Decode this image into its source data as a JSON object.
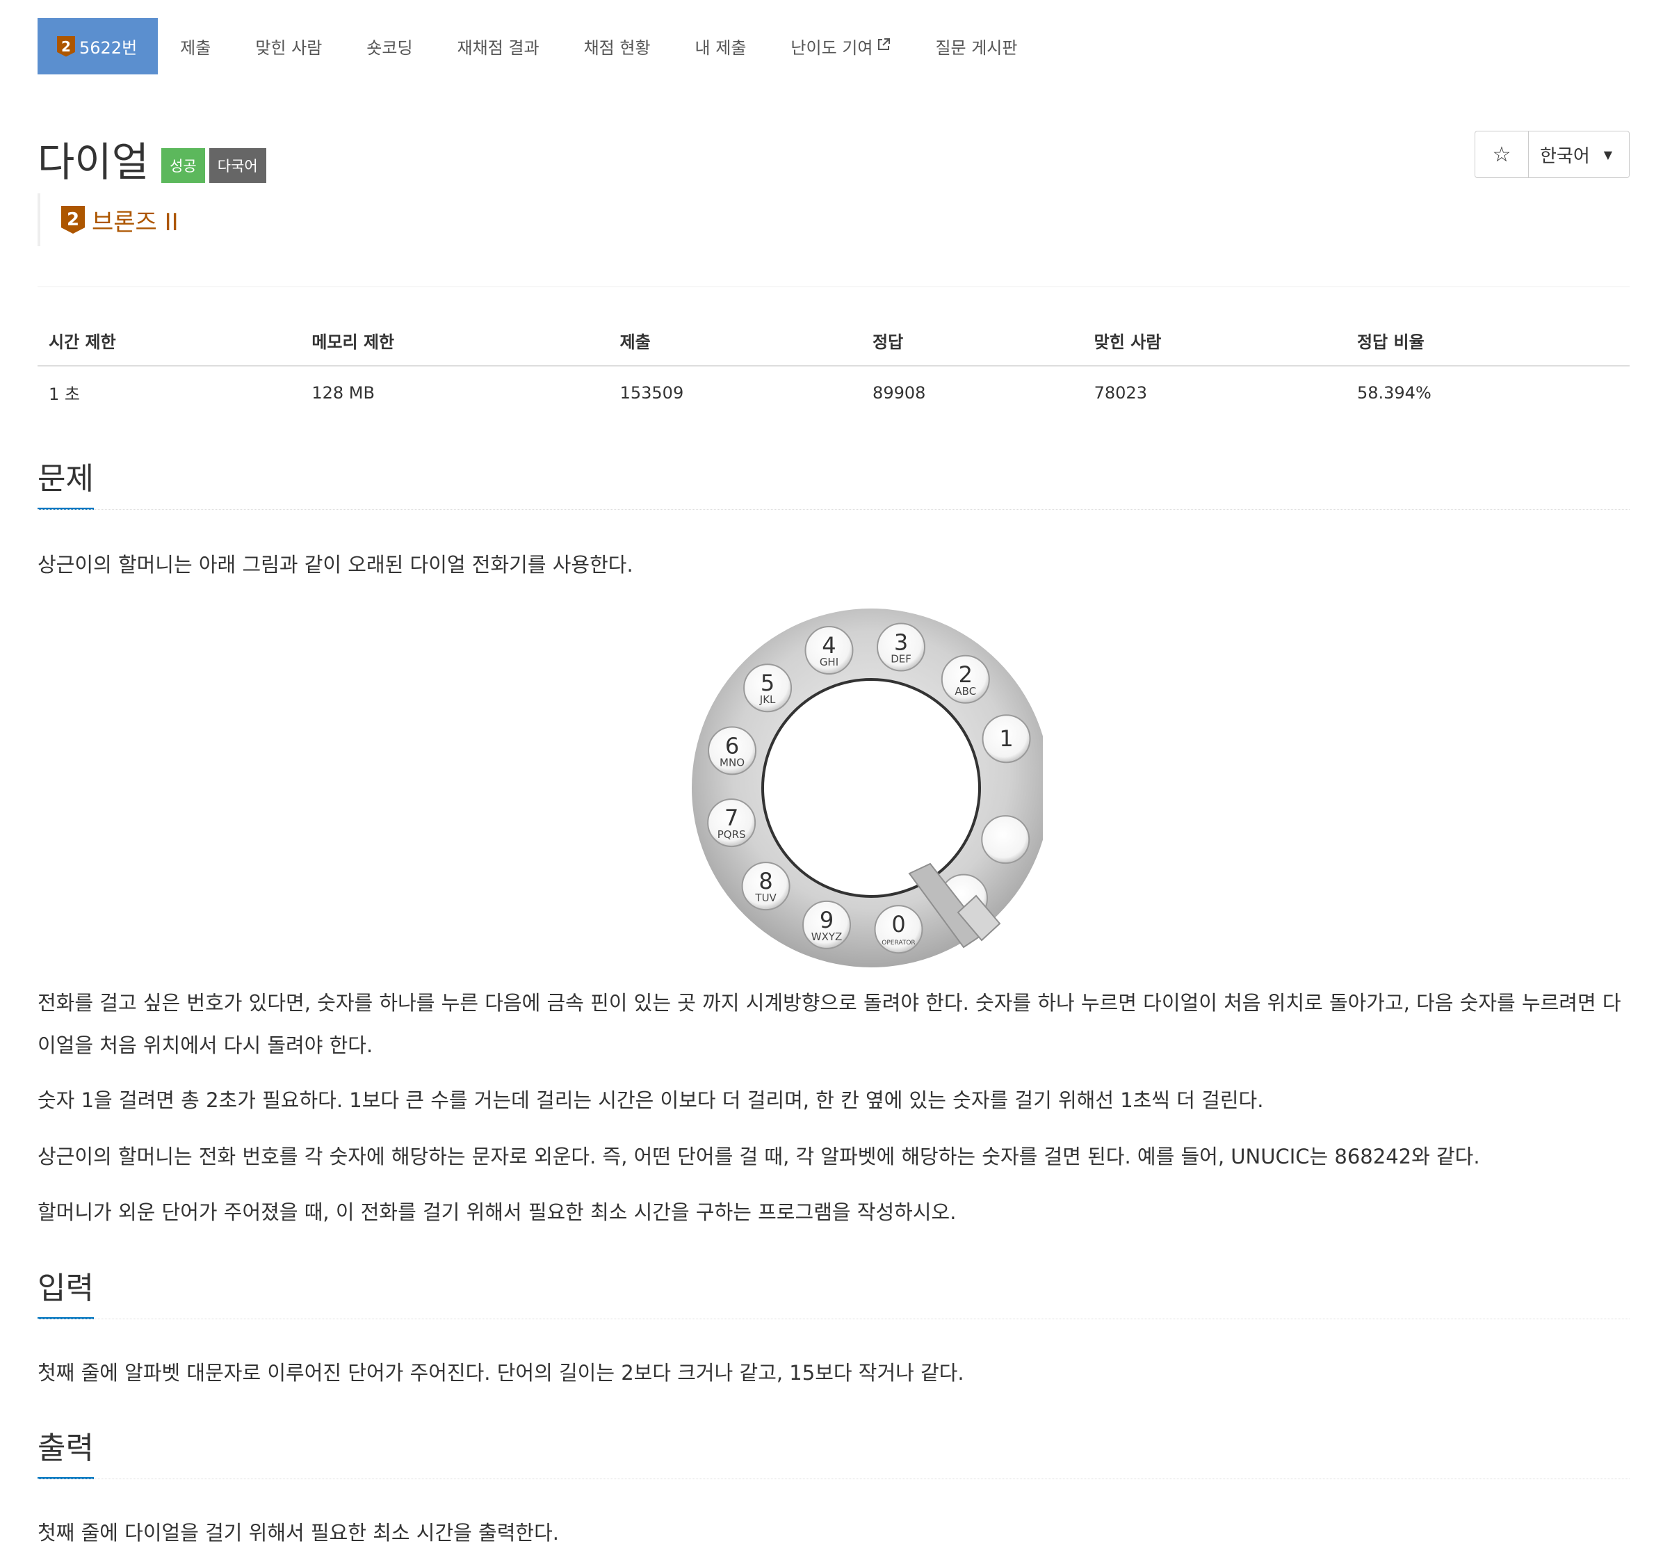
{
  "nav": {
    "problem_id": "5622번",
    "tier_digit": "2",
    "items": [
      "제출",
      "맞힌 사람",
      "숏코딩",
      "재채점 결과",
      "채점 현황",
      "내 제출",
      "난이도 기여",
      "질문 게시판"
    ]
  },
  "problem": {
    "title": "다이얼",
    "label_success": "성공",
    "label_multilang": "다국어",
    "tier": "브론즈 II",
    "tier_digit": "2",
    "tier_color": "#ad5600"
  },
  "tools": {
    "star": "☆",
    "language": "한국어"
  },
  "info": {
    "headers": [
      "시간 제한",
      "메모리 제한",
      "제출",
      "정답",
      "맞힌 사람",
      "정답 비율"
    ],
    "values": [
      "1 초",
      "128 MB",
      "153509",
      "89908",
      "78023",
      "58.394%"
    ]
  },
  "sections": {
    "description": {
      "title": "문제",
      "intro": "상근이의 할머니는 아래 그림과 같이 오래된 다이얼 전화기를 사용한다.",
      "p1": "전화를 걸고 싶은 번호가 있다면, 숫자를 하나를 누른 다음에 금속 핀이 있는 곳 까지 시계방향으로 돌려야 한다. 숫자를 하나 누르면 다이얼이 처음 위치로 돌아가고, 다음 숫자를 누르려면 다이얼을 처음 위치에서 다시 돌려야 한다.",
      "p2": "숫자 1을 걸려면 총 2초가 필요하다. 1보다 큰 수를 거는데 걸리는 시간은 이보다 더 걸리며, 한 칸 옆에 있는 숫자를 걸기 위해선 1초씩 더 걸린다.",
      "p3": "상근이의 할머니는 전화 번호를 각 숫자에 해당하는 문자로 외운다. 즉, 어떤 단어를 걸 때, 각 알파벳에 해당하는 숫자를 걸면 된다. 예를 들어, UNUCIC는 868242와 같다.",
      "p4": "할머니가 외운 단어가 주어졌을 때, 이 전화를 걸기 위해서 필요한 최소 시간을 구하는 프로그램을 작성하시오."
    },
    "input": {
      "title": "입력",
      "text": "첫째 줄에 알파벳 대문자로 이루어진 단어가 주어진다. 단어의 길이는 2보다 크거나 같고, 15보다 작거나 같다."
    },
    "output": {
      "title": "출력",
      "text": "첫째 줄에 다이얼을 걸기 위해서 필요한 최소 시간을 출력한다."
    }
  },
  "dial": {
    "holes": [
      {
        "num": "1",
        "letters": ""
      },
      {
        "num": "2",
        "letters": "ABC"
      },
      {
        "num": "3",
        "letters": "DEF"
      },
      {
        "num": "4",
        "letters": "GHI"
      },
      {
        "num": "5",
        "letters": "JKL"
      },
      {
        "num": "6",
        "letters": "MNO"
      },
      {
        "num": "7",
        "letters": "PQRS"
      },
      {
        "num": "8",
        "letters": "TUV"
      },
      {
        "num": "9",
        "letters": "WXYZ"
      },
      {
        "num": "0",
        "letters": "OPERATOR"
      },
      {
        "num": "",
        "letters": ""
      },
      {
        "num": "",
        "letters": ""
      }
    ]
  }
}
